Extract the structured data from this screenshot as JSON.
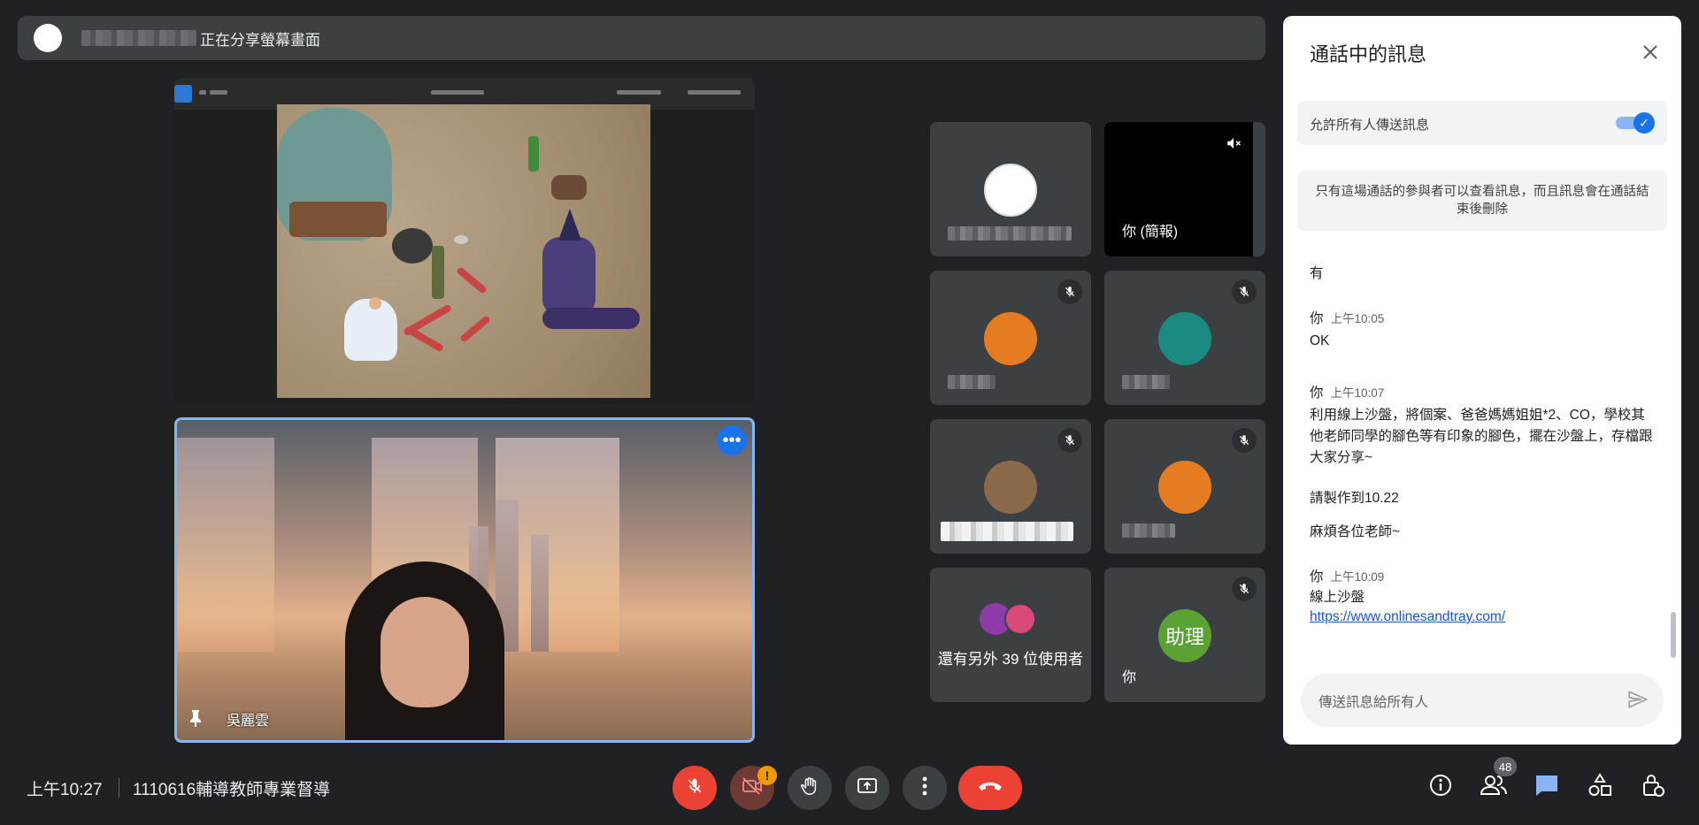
{
  "banner": {
    "sharing_text": "正在分享螢幕畫面"
  },
  "presenter": {
    "name": "吳麗雲"
  },
  "tiles": {
    "self_presenting_label": "你 (簡報)",
    "others_count_label": "還有另外 39 位使用者",
    "assistant_avatar": "助理",
    "assistant_label": "你"
  },
  "chat": {
    "title": "通話中的訊息",
    "allow_label": "允許所有人傳送訊息",
    "allow_enabled": true,
    "notice": "只有這場通話的參與者可以查看訊息，而且訊息會在通話結束後刪除",
    "messages": [
      {
        "sender": "",
        "time": "",
        "lines": [
          "有"
        ]
      },
      {
        "sender": "你",
        "time": "上午10:05",
        "lines": [
          "OK"
        ]
      },
      {
        "sender": "你",
        "time": "上午10:07",
        "lines": [
          "利用線上沙盤，將個案、爸爸媽媽姐姐*2、CO，學校其他老師同學的腳色等有印象的腳色，擺在沙盤上，存檔跟大家分享~",
          "請製作到10.22",
          "麻煩各位老師~"
        ]
      },
      {
        "sender": "你",
        "time": "上午10:09",
        "lines": [
          "線上沙盤"
        ],
        "link": "https://www.onlinesandtray.com/"
      }
    ],
    "input_placeholder": "傳送訊息給所有人"
  },
  "bottom": {
    "time": "上午10:27",
    "meeting_name": "1110616輔導教師專業督導",
    "camera_warning": "!",
    "participants_count": "48"
  },
  "colors": {
    "background": "#202124",
    "tile": "#3c4043",
    "accent": "#1a73e8",
    "danger": "#ea4335",
    "warning": "#f29900",
    "highlight": "#8ab4f8"
  },
  "icons": [
    "mic-off-icon",
    "camera-off-icon",
    "raise-hand-icon",
    "present-icon",
    "more-vert-icon",
    "hangup-icon",
    "info-icon",
    "people-icon",
    "chat-icon",
    "activities-icon",
    "host-controls-icon",
    "send-icon",
    "close-icon",
    "pin-icon",
    "more-horiz-icon",
    "volume-off-icon"
  ]
}
